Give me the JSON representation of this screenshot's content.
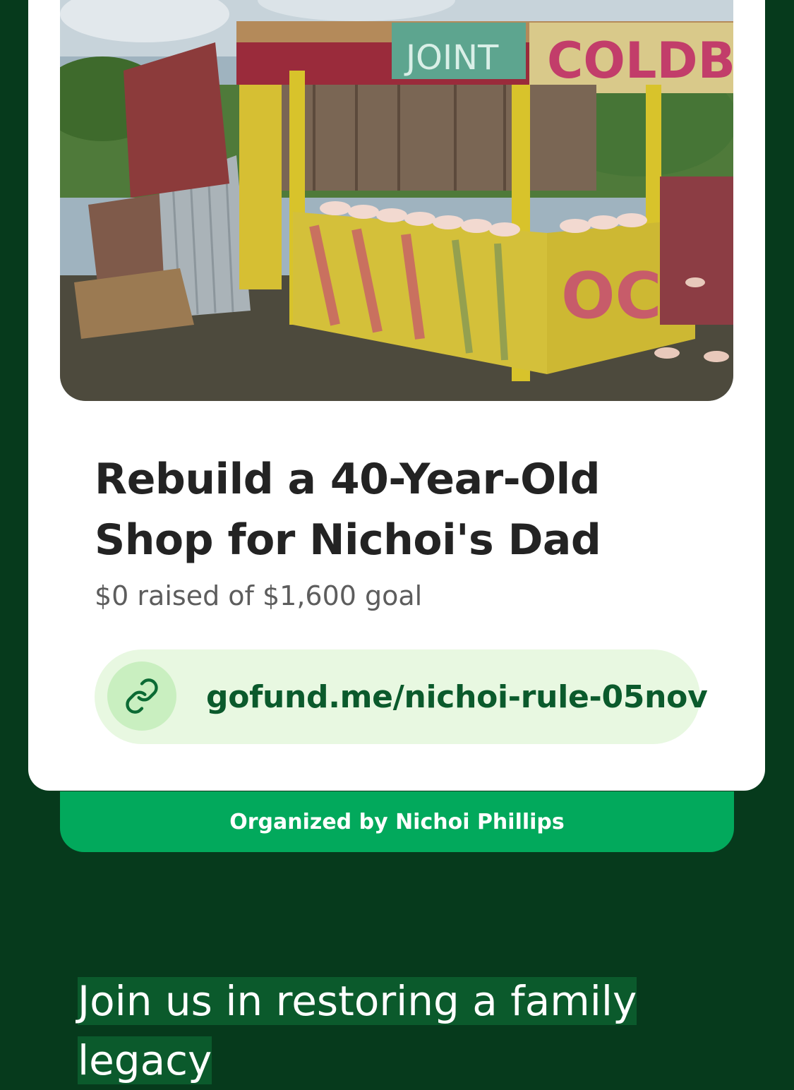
{
  "campaign": {
    "photo_description_icon": "shop-photo",
    "title": "Rebuild a 40-Year-Old Shop for Nichoi's Dad",
    "raised_text": "$0 raised of $1,600 goal",
    "link": {
      "icon": "link-icon",
      "url": "gofund.me/nichoi-rule-05nov"
    },
    "organizer_text": "Organized by Nichoi Phillips"
  },
  "headline": "Join us in restoring a family legacy",
  "colors": {
    "background": "#063a1c",
    "brand_green": "#02a95c",
    "link_text": "#0b5a2c",
    "pill_bg": "#e8f8e1"
  }
}
